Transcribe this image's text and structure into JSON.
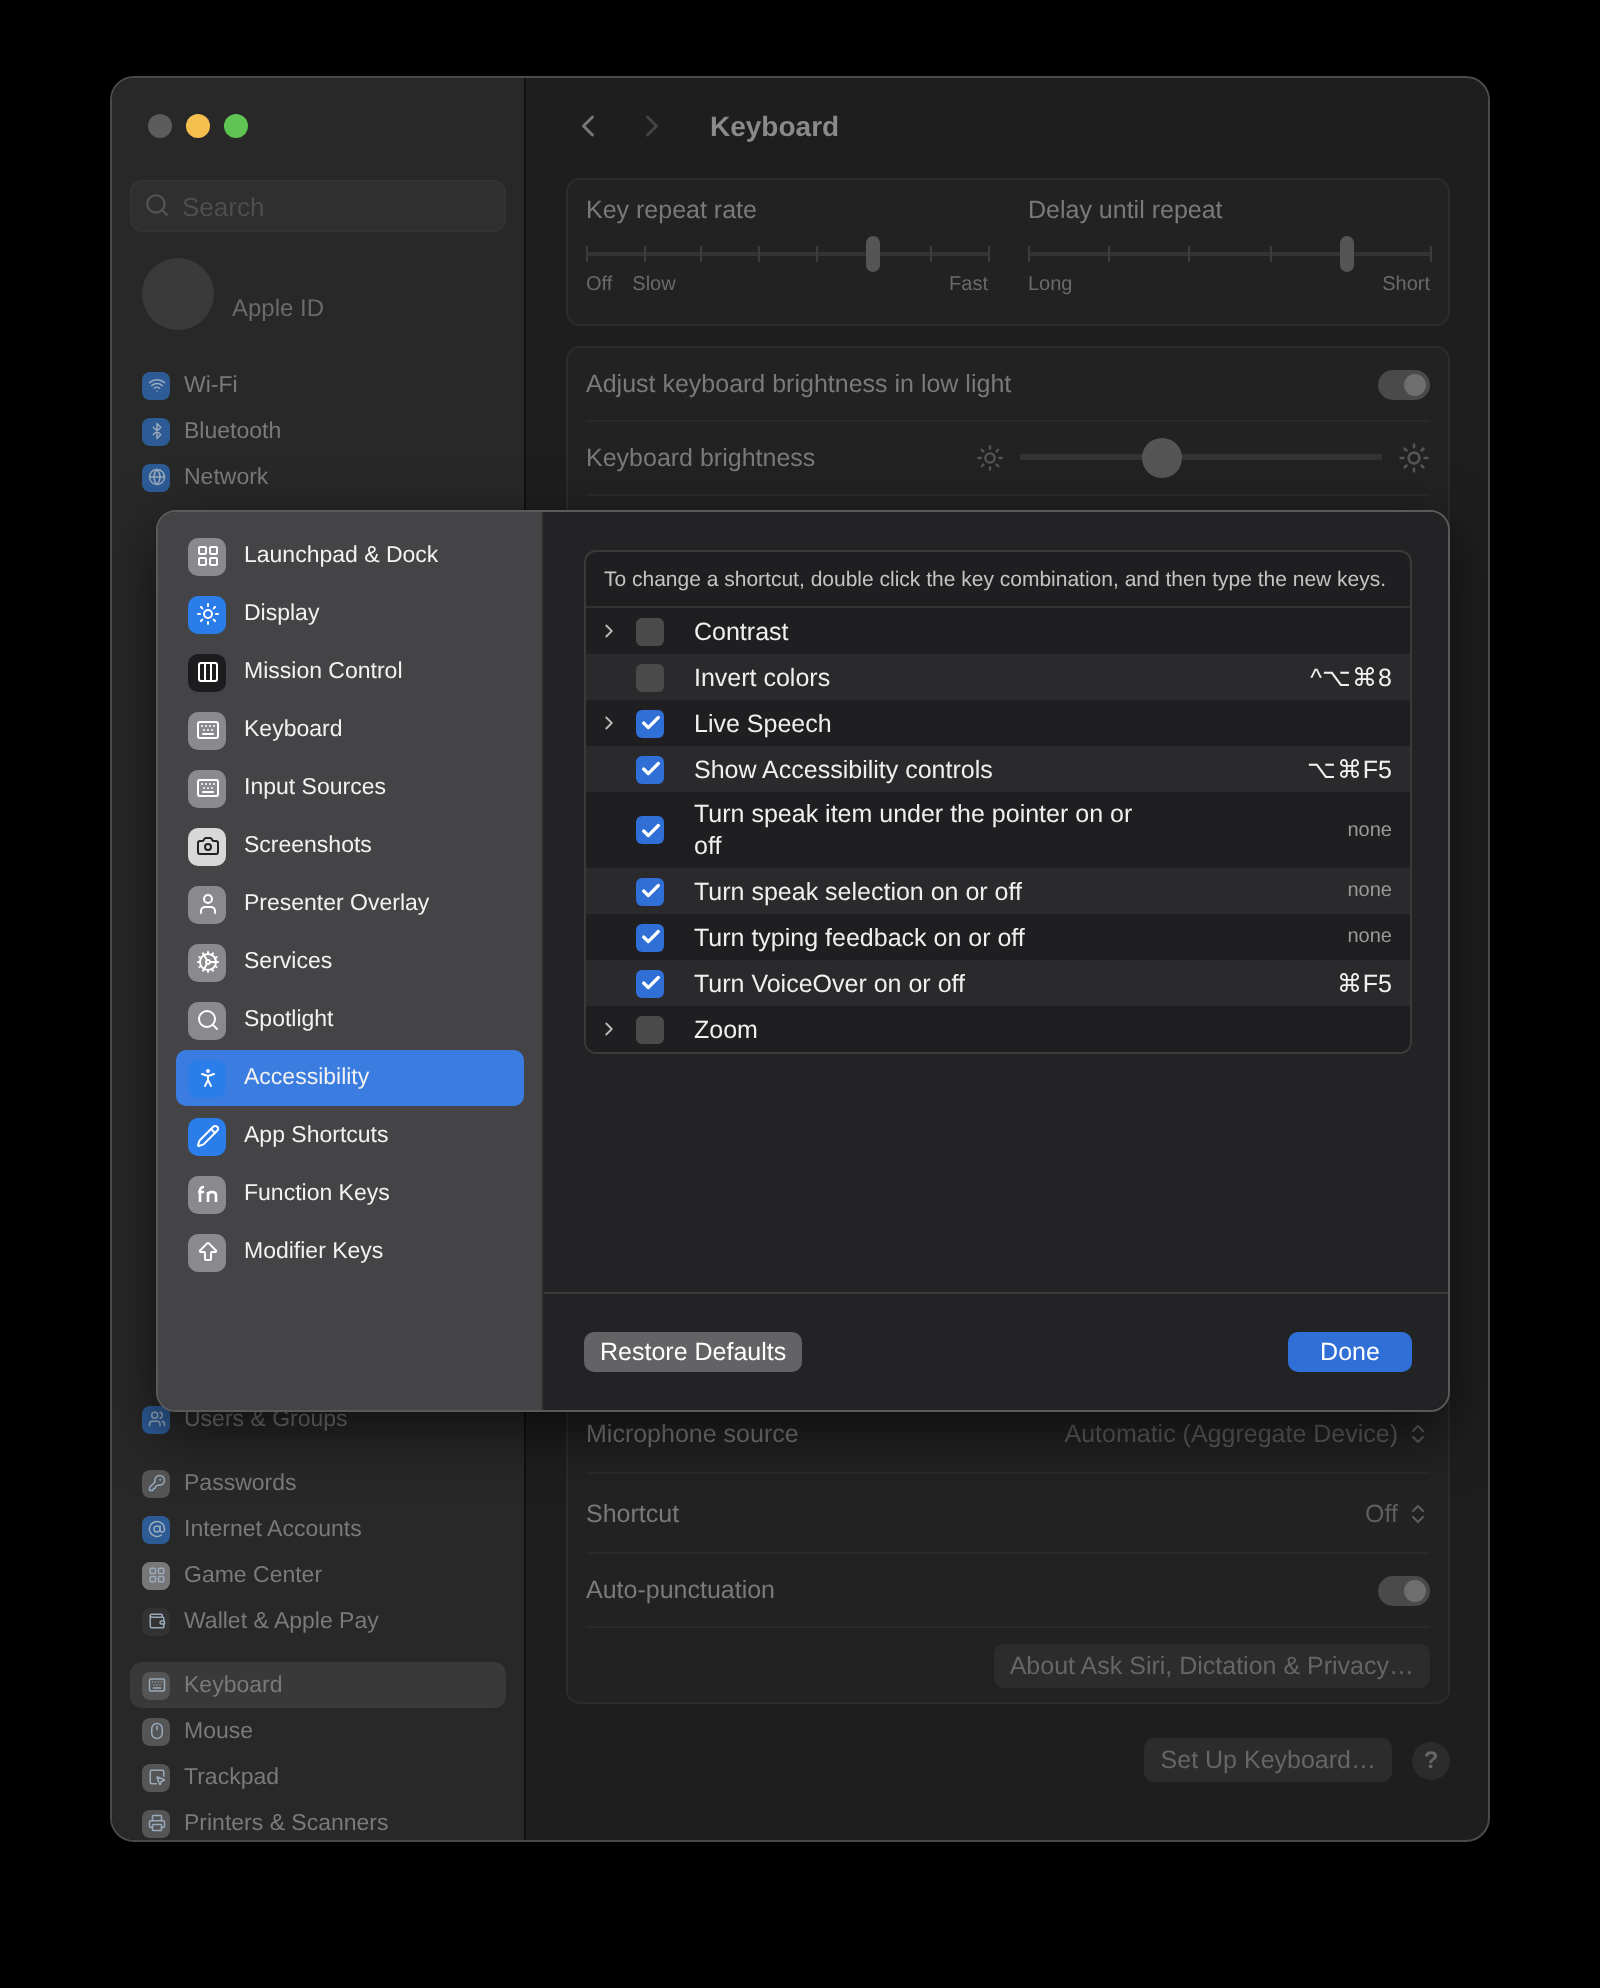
{
  "sidebar": {
    "search": {
      "placeholder": "Search"
    },
    "account": "Apple ID",
    "items_top": [
      {
        "label": "Wi-Fi",
        "selected": false
      },
      {
        "label": "Bluetooth",
        "selected": false
      },
      {
        "label": "Network",
        "selected": false
      }
    ],
    "items_middle": [
      {
        "label": "Users & Groups",
        "selected": false
      }
    ],
    "items_accounts": [
      {
        "label": "Passwords",
        "selected": false
      },
      {
        "label": "Internet Accounts",
        "selected": false
      },
      {
        "label": "Game Center",
        "selected": false
      },
      {
        "label": "Wallet & Apple Pay",
        "selected": false
      }
    ],
    "items_devices": [
      {
        "label": "Keyboard",
        "selected": true
      },
      {
        "label": "Mouse",
        "selected": false
      },
      {
        "label": "Trackpad",
        "selected": false
      },
      {
        "label": "Printers & Scanners",
        "selected": false
      }
    ]
  },
  "content": {
    "title": "Keyboard",
    "repeat": [
      {
        "label": "Key repeat rate",
        "level": 0.71,
        "captions": [
          "Off",
          "Slow",
          "Fast"
        ]
      },
      {
        "label": "Delay until repeat",
        "level": 0.79,
        "captions": [
          "Long",
          "Short"
        ]
      }
    ],
    "settings_top": [
      {
        "kind": "toggle",
        "label": "Adjust keyboard brightness in low light",
        "on": true
      },
      {
        "kind": "slider",
        "label": "Keyboard brightness",
        "level": 0.39
      }
    ],
    "settings_bottom": [
      {
        "kind": "popup",
        "label": "Microphone source",
        "value": "Automatic (Aggregate Device)"
      },
      {
        "kind": "popup",
        "label": "Shortcut",
        "value": "Off"
      },
      {
        "kind": "toggle",
        "label": "Auto-punctuation",
        "on": true
      },
      {
        "kind": "button",
        "label": "About Ask Siri, Dictation & Privacy…"
      }
    ],
    "footer_button": "Set Up Keyboard…",
    "help": "?"
  },
  "sheet": {
    "categories": [
      {
        "label": "Launchpad & Dock",
        "selected": false
      },
      {
        "label": "Display",
        "selected": false
      },
      {
        "label": "Mission Control",
        "selected": false
      },
      {
        "label": "Keyboard",
        "selected": false
      },
      {
        "label": "Input Sources",
        "selected": false
      },
      {
        "label": "Screenshots",
        "selected": false
      },
      {
        "label": "Presenter Overlay",
        "selected": false
      },
      {
        "label": "Services",
        "selected": false
      },
      {
        "label": "Spotlight",
        "selected": false
      },
      {
        "label": "Accessibility",
        "selected": true
      },
      {
        "label": "App Shortcuts",
        "selected": false
      },
      {
        "label": "Function Keys",
        "selected": false
      },
      {
        "label": "Modifier Keys",
        "selected": false
      }
    ],
    "instructions": "To change a shortcut, double click the key combination, and then type the new keys.",
    "shortcuts": [
      {
        "label": "Contrast",
        "expandable": true,
        "checked": false
      },
      {
        "label": "Invert colors",
        "expandable": false,
        "checked": false,
        "shortcut": "^⌥⌘8",
        "assigned": true
      },
      {
        "label": "Live Speech",
        "expandable": true,
        "checked": true
      },
      {
        "label": "Show Accessibility controls",
        "expandable": false,
        "checked": true,
        "shortcut": "⌥⌘F5",
        "assigned": true
      },
      {
        "label": "Turn speak item under the pointer on or off",
        "expandable": false,
        "checked": true,
        "shortcut": "none",
        "assigned": false
      },
      {
        "label": "Turn speak selection on or off",
        "expandable": false,
        "checked": true,
        "shortcut": "none",
        "assigned": false
      },
      {
        "label": "Turn typing feedback on or off",
        "expandable": false,
        "checked": true,
        "shortcut": "none",
        "assigned": false
      },
      {
        "label": "Turn VoiceOver on or off",
        "expandable": false,
        "checked": true,
        "shortcut": "⌘F5",
        "assigned": true
      },
      {
        "label": "Zoom",
        "expandable": true,
        "checked": false
      }
    ],
    "buttons": [
      {
        "label": "Restore Defaults",
        "kind": "secondary"
      },
      {
        "label": "Done",
        "kind": "primary"
      }
    ]
  }
}
